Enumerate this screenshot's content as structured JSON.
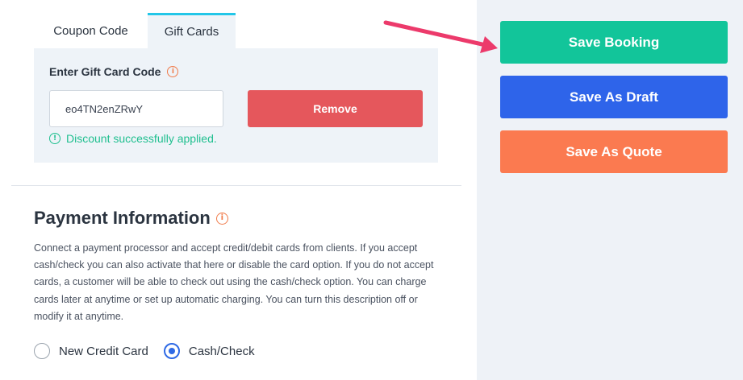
{
  "tabs": [
    {
      "label": "Coupon Code",
      "active": false
    },
    {
      "label": "Gift Cards",
      "active": true
    }
  ],
  "gift_card": {
    "label": "Enter Gift Card Code",
    "code_value": "eo4TN2enZRwY",
    "remove_label": "Remove",
    "success_message": "Discount successfully applied."
  },
  "payment": {
    "title": "Payment Information",
    "description": "Connect a payment processor and accept credit/debit cards from clients. If you accept cash/check you can also activate that here or disable the card option. If you do not accept cards, a customer will be able to check out using the cash/check option. You can charge cards later at anytime or set up automatic charging. You can turn this description off or modify it at anytime.",
    "options": [
      {
        "label": "New Credit Card",
        "selected": false
      },
      {
        "label": "Cash/Check",
        "selected": true
      }
    ]
  },
  "actions": {
    "save_booking": "Save Booking",
    "save_draft": "Save As Draft",
    "save_quote": "Save As Quote"
  },
  "colors": {
    "active_tab_border": "#22c6e8",
    "remove": "#e5575c",
    "success": "#1fbf8f",
    "save_booking": "#12c59a",
    "save_draft": "#2e64ea",
    "save_quote": "#fb7a50",
    "annotation_arrow": "#ec3a6b",
    "info_icon": "#f07b4a"
  },
  "icons": {
    "info": "info-circle-icon",
    "success": "success-circle-icon",
    "annotation": "pointer-arrow-icon"
  }
}
